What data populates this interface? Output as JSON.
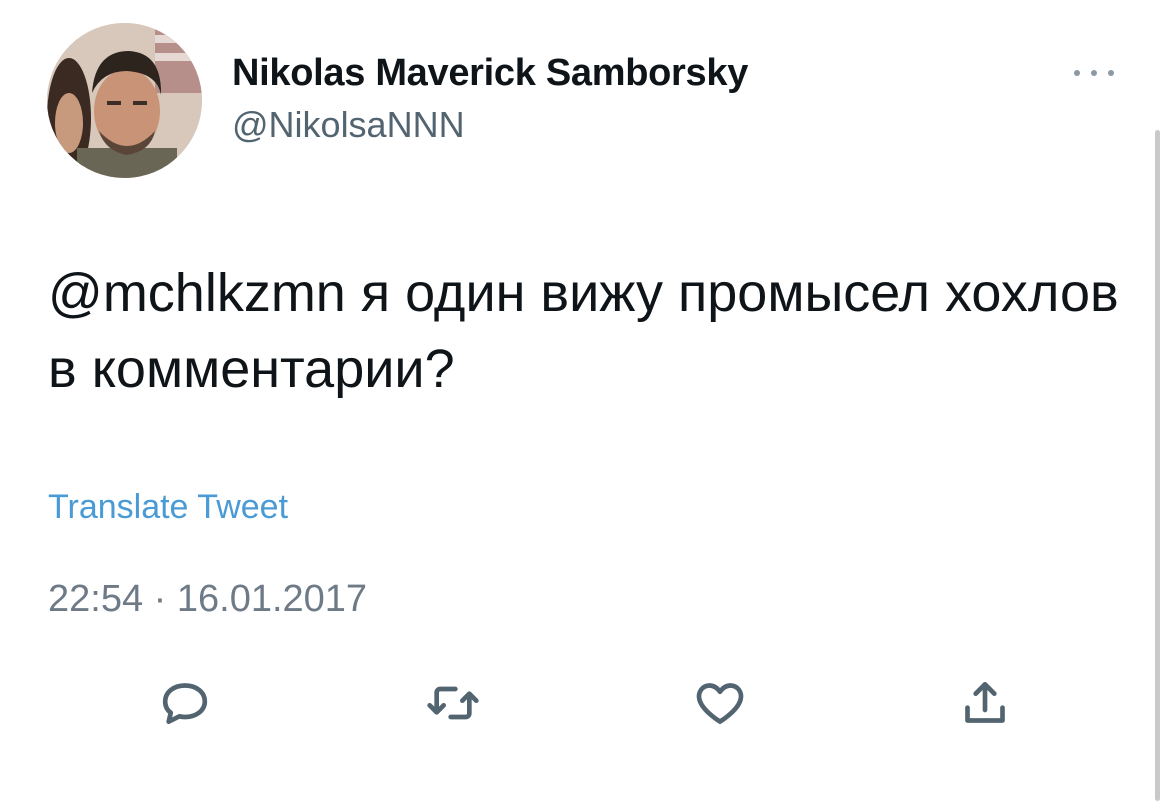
{
  "author": {
    "display_name": "Nikolas Maverick Samborsky",
    "handle": "@NikolsaNNN",
    "avatar_icon": "user-avatar-image"
  },
  "header": {
    "more_icon": "more-horizontal-icon"
  },
  "tweet": {
    "text": "@mchlkzmn я один вижу промысел хохлов в комментарии?",
    "translate_label": "Translate Tweet",
    "timestamp": "22:54 · 16.01.2017"
  },
  "actions": [
    {
      "name": "reply",
      "icon": "reply-icon"
    },
    {
      "name": "retweet",
      "icon": "retweet-icon"
    },
    {
      "name": "like",
      "icon": "heart-icon"
    },
    {
      "name": "share",
      "icon": "share-icon"
    }
  ],
  "colors": {
    "text_primary": "#0f1419",
    "text_secondary": "#536471",
    "link": "#4a9ad6",
    "icon": "#536471"
  }
}
